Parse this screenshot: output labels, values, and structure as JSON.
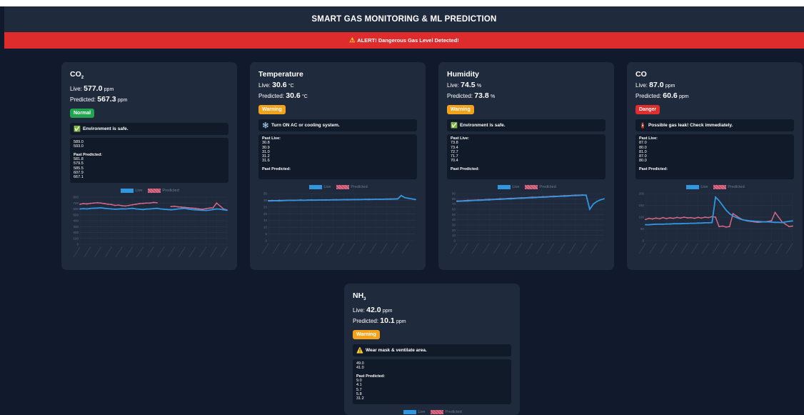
{
  "title": "SMART GAS MONITORING & ML PREDICTION",
  "alert": {
    "icon": "warning-icon",
    "text": "ALERT! Dangerous Gas Level Detected!"
  },
  "labels": {
    "live": "Live:",
    "predicted": "Predicted:",
    "past_live": "Past Live:",
    "past_predicted": "Past Predicted:"
  },
  "colors": {
    "normal": "#22a350",
    "warning": "#f2a31b",
    "danger": "#e02d2d",
    "live_line": "#3196e0",
    "pred_line": "#e06a86"
  },
  "cards": [
    {
      "name": "CO",
      "sub": "2",
      "live": "577.0",
      "predicted": "567.3",
      "unit": "ppm",
      "status": "Normal",
      "status_color": "#22a350",
      "message_icon": "check-icon",
      "message": "Environment is safe.",
      "past_live_visible": [
        "589.0",
        "593.0"
      ],
      "past_predicted": [
        "581.8",
        "579.5",
        "585.5",
        "607.9",
        "667.1"
      ],
      "legend": {
        "live": "Live",
        "predicted": "Predicted"
      },
      "chart_data": {
        "type": "line",
        "ylim": [
          0,
          800
        ],
        "yticks": [
          "800",
          "700",
          "600",
          "500",
          "400",
          "300",
          "200",
          "100",
          "0"
        ],
        "series": [
          {
            "name": "Live",
            "values": [
              600,
              605,
              600,
              608,
              612,
              615,
              620,
              610,
              605,
              600,
              595,
              598,
              602,
              600,
              605,
              610,
              600,
              595,
              590,
              598,
              600,
              605,
              610,
              600,
              595,
              590,
              585,
              592,
              600,
              605,
              610,
              598,
              590,
              585,
              580,
              578,
              575,
              580,
              590,
              600,
              595,
              585,
              578
            ]
          },
          {
            "name": "Predicted",
            "values": [
              680,
              690,
              685,
              695,
              700,
              705,
              700,
              690,
              680,
              675,
              660,
              665,
              655,
              650,
              660,
              670,
              680,
              690,
              695,
              700,
              700,
              710,
              705,
              null,
              null,
              null,
              640,
              645,
              635,
              630,
              625,
              620,
              615,
              610,
              600,
              595,
              605,
              615,
              620,
              700,
              650,
              600,
              580
            ]
          }
        ]
      }
    },
    {
      "name": "Temperature",
      "sub": "",
      "live": "30.6",
      "predicted": "30.6",
      "unit": "°C",
      "status": "Warning",
      "status_color": "#f2a31b",
      "message_icon": "snowflake-icon",
      "message": "Turn ON AC or cooling system.",
      "past_live_visible": [
        "30.8",
        "30.9",
        "31.0",
        "31.2",
        "31.6"
      ],
      "past_predicted": [],
      "legend": {
        "live": "Live",
        "predicted": "Predicted"
      },
      "chart_data": {
        "type": "line",
        "ylim": [
          0,
          35
        ],
        "yticks": [
          "35",
          "30",
          "25",
          "20",
          "15",
          "10",
          "5",
          "0"
        ],
        "series": [
          {
            "name": "Live",
            "values": [
              29.5,
              29.6,
              29.7,
              29.6,
              29.8,
              29.9,
              30.0,
              29.9,
              30.0,
              30.1,
              30.0,
              30.1,
              30.2,
              30.1,
              30.2,
              30.3,
              30.2,
              30.3,
              30.4,
              30.3,
              30.4,
              30.5,
              30.4,
              30.5,
              30.6,
              30.5,
              30.6,
              30.7,
              30.6,
              30.7,
              30.8,
              30.7,
              30.8,
              30.9,
              30.8,
              30.9,
              31.0,
              33.5,
              32.0,
              31.5,
              31.0,
              30.6
            ]
          },
          {
            "name": "Predicted",
            "values": [
              29.8,
              29.9,
              29.8,
              30.0,
              29.9,
              30.0,
              30.1,
              30.0,
              30.1,
              30.2,
              30.1,
              30.2,
              30.3,
              30.2,
              30.3,
              30.3,
              30.4,
              30.3,
              30.4,
              30.5,
              30.4,
              30.5,
              30.6,
              30.5,
              30.6,
              30.7,
              30.6,
              30.7,
              30.8,
              30.7,
              30.8,
              30.9,
              30.8,
              30.9,
              31.0,
              31.1,
              31.2,
              null,
              null,
              null,
              null,
              null
            ]
          }
        ]
      }
    },
    {
      "name": "Humidity",
      "sub": "",
      "live": "74.5",
      "predicted": "73.8",
      "unit": "%",
      "status": "Warning",
      "status_color": "#f2a31b",
      "message_icon": "check-icon",
      "message": "Environment is safe.",
      "past_live_visible": [
        "73.8",
        "73.4",
        "72.7",
        "71.7",
        "70.4"
      ],
      "past_predicted": [],
      "legend": {
        "live": "Live",
        "predicted": "Predicted"
      },
      "chart_data": {
        "type": "line",
        "ylim": [
          0,
          90
        ],
        "yticks": [
          "90",
          "80",
          "70",
          "60",
          "50",
          "40",
          "30",
          "20",
          "10",
          "0"
        ],
        "series": [
          {
            "name": "Live",
            "values": [
              75,
              75.5,
              76,
              76,
              76.5,
              77,
              77,
              77.5,
              78,
              78,
              78.5,
              79,
              79,
              79.5,
              80,
              80,
              80.5,
              81,
              81,
              81.5,
              82,
              82,
              82.5,
              83,
              83,
              83.5,
              84,
              84,
              84.5,
              85,
              85,
              85.5,
              86,
              86,
              86.5,
              87,
              87,
              60,
              70,
              75,
              78,
              80
            ]
          },
          {
            "name": "Predicted",
            "values": [
              76,
              76,
              76.5,
              77,
              77,
              77.5,
              78,
              78,
              78.5,
              79,
              79,
              79.5,
              80,
              80,
              80.5,
              81,
              81,
              81.5,
              82,
              82,
              82.5,
              83,
              83,
              83.5,
              84,
              84,
              84.5,
              85,
              85,
              85.5,
              86,
              86,
              86.5,
              87,
              87,
              87.5,
              null,
              null,
              null,
              null,
              null,
              null
            ]
          }
        ]
      }
    },
    {
      "name": "CO",
      "sub": "",
      "live": "87.0",
      "predicted": "60.6",
      "unit": "ppm",
      "status": "Danger",
      "status_color": "#e02d2d",
      "message_icon": "danger-icon",
      "message": "Possible gas leak! Check immediately.",
      "past_live_visible": [
        "87.0",
        "80.0",
        "81.0",
        "87.0",
        "80.0"
      ],
      "past_predicted": [],
      "legend": {
        "live": "Live",
        "predicted": "Predicted"
      },
      "chart_data": {
        "type": "line",
        "ylim": [
          0,
          200
        ],
        "yticks": [
          "200",
          "150",
          "100",
          "50",
          "0"
        ],
        "series": [
          {
            "name": "Live",
            "values": [
              68,
              68,
              69,
              70,
              70,
              70,
              71,
              71,
              72,
              72,
              72,
              73,
              73,
              74,
              74,
              75,
              75,
              76,
              76,
              77,
              185,
              170,
              150,
              130,
              115,
              105,
              98,
              92,
              88,
              86,
              84,
              83,
              82,
              81,
              80,
              80,
              79,
              78,
              78,
              77,
              80,
              82,
              84
            ]
          },
          {
            "name": "Predicted",
            "values": [
              90,
              95,
              92,
              96,
              93,
              98,
              94,
              97,
              95,
              99,
              96,
              100,
              97,
              98,
              95,
              99,
              96,
              100,
              98,
              102,
              100,
              60,
              62,
              58,
              60,
              115,
              105,
              95,
              88,
              84,
              82,
              80,
              78,
              79,
              80,
              82,
              85,
              120,
              100,
              80,
              70,
              60,
              62
            ]
          }
        ]
      }
    },
    {
      "name": "NH",
      "sub": "3",
      "live": "42.0",
      "predicted": "10.1",
      "unit": "ppm",
      "status": "Warning",
      "status_color": "#f2a31b",
      "message_icon": "warning-icon",
      "message": "Wear mask & ventilate area.",
      "past_live_visible": [
        "49.0",
        "41.0"
      ],
      "past_predicted": [
        "9.0",
        "4.1",
        "5.7",
        "5.8",
        "31.2"
      ],
      "legend": {
        "live": "Live",
        "predicted": "Predicted"
      }
    }
  ]
}
